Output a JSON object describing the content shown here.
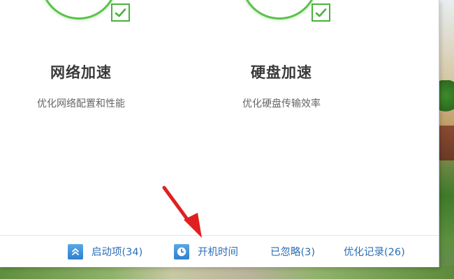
{
  "features": [
    {
      "title": "网络加速",
      "description": "优化网络配置和性能",
      "icon": "check-icon"
    },
    {
      "title": "硬盘加速",
      "description": "优化硬盘传输效率",
      "icon": "check-icon"
    }
  ],
  "bottom_bar": {
    "startup_label": "启动项(34)",
    "boot_time_label": "开机时间",
    "ignored_label": "已忽略(3)",
    "history_label": "优化记录(26)"
  },
  "colors": {
    "accent_green": "#5cc24c",
    "link_blue": "#2c6fb6",
    "annotation_red": "#e02020"
  }
}
